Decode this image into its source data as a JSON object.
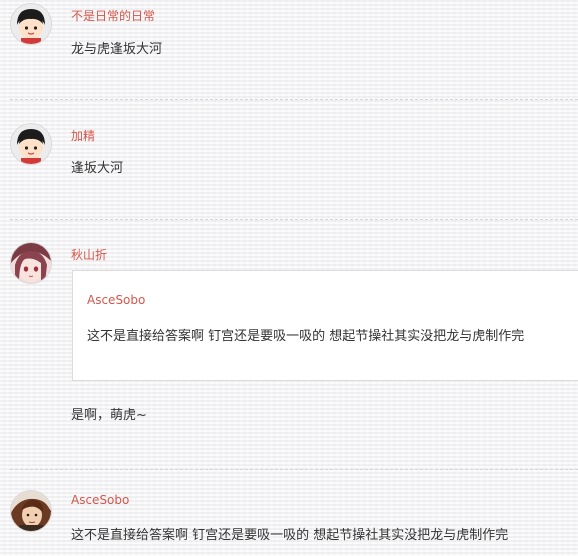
{
  "comments": [
    {
      "username": "不是日常的日常",
      "text": "龙与虎逢坂大河",
      "avatar_icon": "cartoon-boy-avatar-icon"
    },
    {
      "username": "加精",
      "text": "逢坂大河",
      "avatar_icon": "cartoon-boy-avatar-icon"
    },
    {
      "username": "秋山折",
      "avatar_icon": "anime-girl-avatar-icon",
      "quote": {
        "username": "AsceSobo",
        "text": "这不是直接给答案啊 钉宫还是要吸一吸的 想起节操社其实没把龙与虎制作完"
      },
      "text": "是啊，萌虎~"
    },
    {
      "username": "AsceSobo",
      "text": "这不是直接给答案啊 钉宫还是要吸一吸的 想起节操社其实没把龙与虎制作完",
      "avatar_icon": "warrior-avatar-icon"
    }
  ],
  "colors": {
    "username": "#d4564a",
    "text": "#333333",
    "background": "#f3f3f5"
  }
}
